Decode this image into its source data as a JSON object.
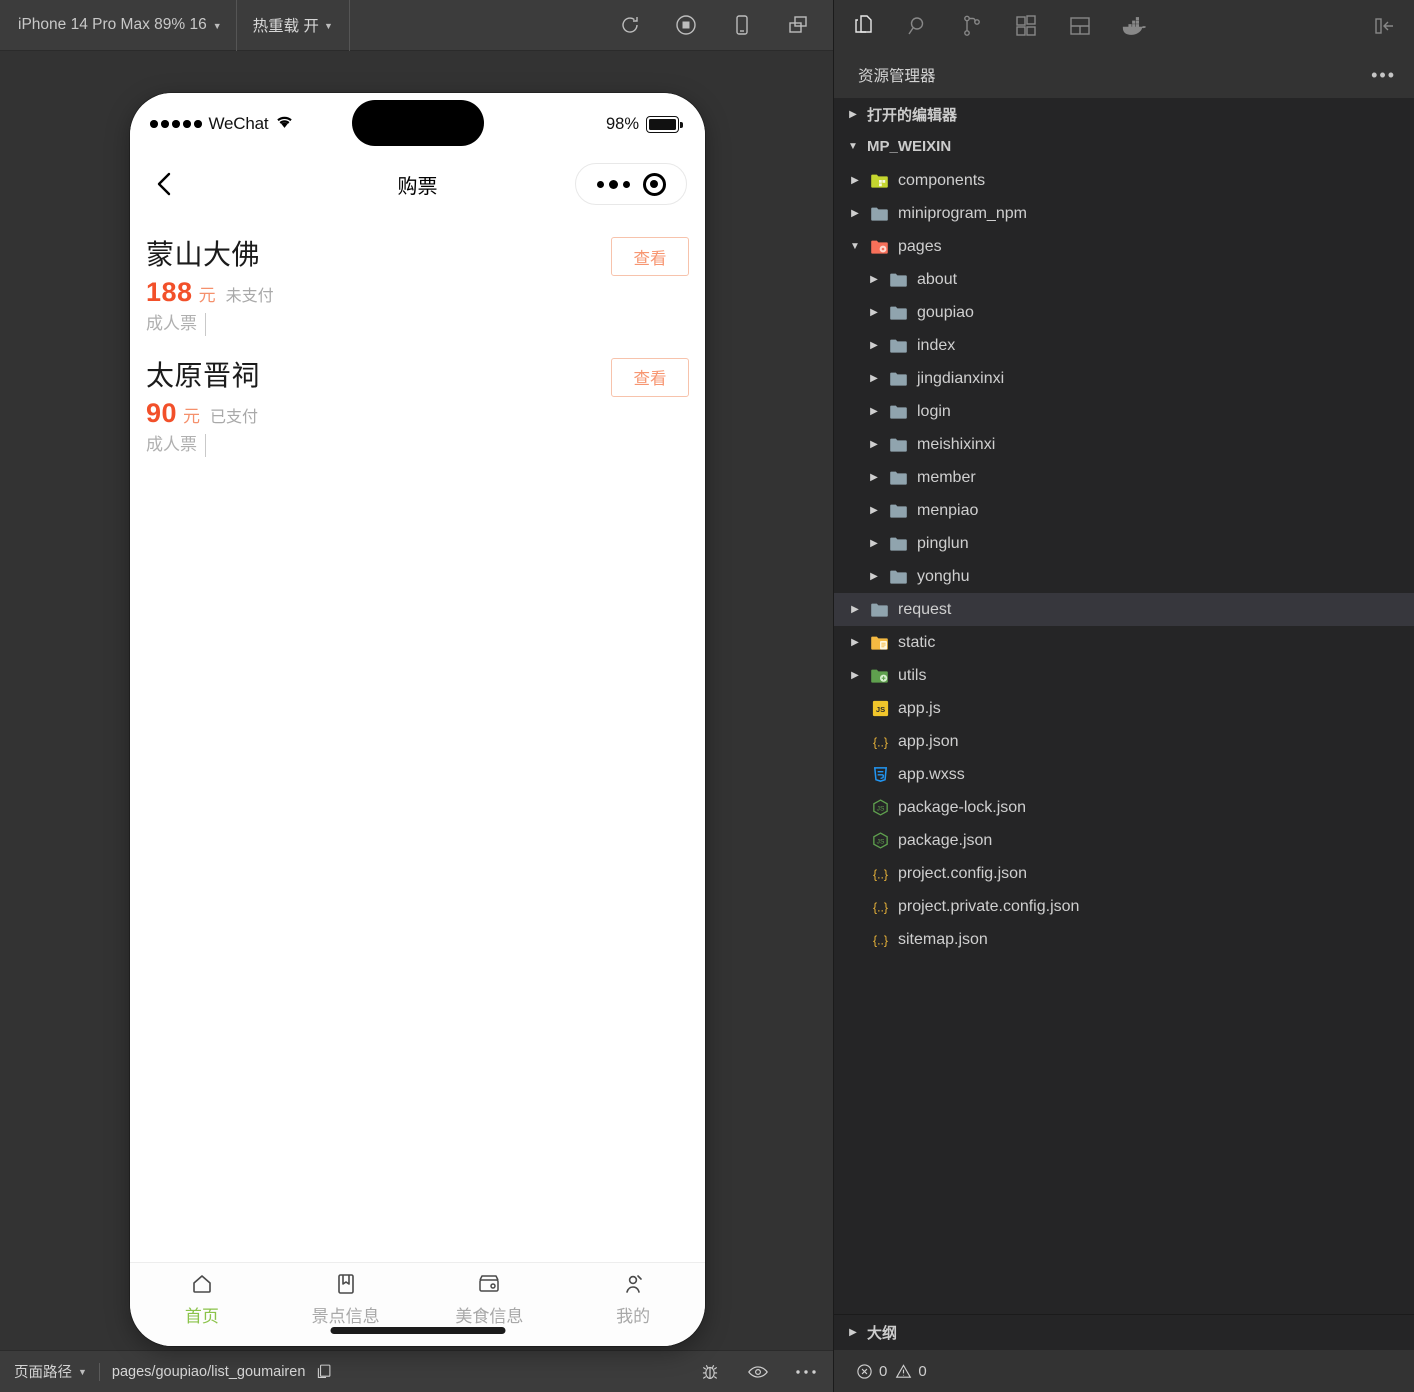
{
  "simulator": {
    "toolbar": {
      "device_label": "iPhone 14 Pro Max 89% 16",
      "hotreload_label": "热重载 开",
      "icons": [
        "refresh-icon",
        "record-stop-icon",
        "device-phone-icon",
        "window-split-icon"
      ]
    },
    "phone": {
      "status_bar": {
        "carrier": "WeChat",
        "signal_dots": 5,
        "wifi": "wifi-icon",
        "battery_percent": "98%"
      },
      "nav": {
        "back": "back-chevron-icon",
        "title": "购票",
        "capsule": [
          "more-dots-icon",
          "target-circle-icon"
        ]
      },
      "tickets": [
        {
          "name": "蒙山大佛",
          "price": "188",
          "currency": "元",
          "pay_status": "未支付",
          "ticket_type": "成人票",
          "action": "查看"
        },
        {
          "name": "太原晋祠",
          "price": "90",
          "currency": "元",
          "pay_status": "已支付",
          "ticket_type": "成人票",
          "action": "查看"
        }
      ],
      "tabbar": [
        {
          "label": "首页",
          "icon": "home-icon",
          "active": true
        },
        {
          "label": "景点信息",
          "icon": "bookmark-icon",
          "active": false
        },
        {
          "label": "美食信息",
          "icon": "shop-icon",
          "active": false
        },
        {
          "label": "我的",
          "icon": "person-icon",
          "active": false
        }
      ]
    },
    "path_bar": {
      "selector_label": "页面路径",
      "path": "pages/goupiao/list_goumairen",
      "copy_icon": "copy-icon",
      "right_icons": [
        "bug-icon",
        "eye-icon",
        "ellipsis-icon"
      ]
    }
  },
  "vscode": {
    "activity_bar": {
      "icons": [
        "explorer-files-icon",
        "search-icon",
        "source-control-icon",
        "extensions-icon",
        "layout-icon",
        "docker-icon"
      ],
      "collapse_icon": "collapse-panel-icon"
    },
    "panel_title": "资源管理器",
    "more_icon": "ellipsis-icon",
    "sections": {
      "open_editors": "打开的编辑器",
      "workspace": "MP_WEIXIN",
      "outline": "大纲"
    },
    "tree": [
      {
        "label": "components",
        "type": "folder",
        "icon_color": "#C5D62F",
        "indent": 0,
        "expanded": false
      },
      {
        "label": "miniprogram_npm",
        "type": "folder",
        "icon_color": "#90a4ae",
        "indent": 0,
        "expanded": false
      },
      {
        "label": "pages",
        "type": "folder",
        "icon_color": "#F8705A",
        "indent": 0,
        "expanded": true
      },
      {
        "label": "about",
        "type": "folder",
        "icon_color": "#90a4ae",
        "indent": 1,
        "expanded": false
      },
      {
        "label": "goupiao",
        "type": "folder",
        "icon_color": "#90a4ae",
        "indent": 1,
        "expanded": false
      },
      {
        "label": "index",
        "type": "folder",
        "icon_color": "#90a4ae",
        "indent": 1,
        "expanded": false
      },
      {
        "label": "jingdianxinxi",
        "type": "folder",
        "icon_color": "#90a4ae",
        "indent": 1,
        "expanded": false
      },
      {
        "label": "login",
        "type": "folder",
        "icon_color": "#90a4ae",
        "indent": 1,
        "expanded": false
      },
      {
        "label": "meishixinxi",
        "type": "folder",
        "icon_color": "#90a4ae",
        "indent": 1,
        "expanded": false
      },
      {
        "label": "member",
        "type": "folder",
        "icon_color": "#90a4ae",
        "indent": 1,
        "expanded": false
      },
      {
        "label": "menpiao",
        "type": "folder",
        "icon_color": "#90a4ae",
        "indent": 1,
        "expanded": false
      },
      {
        "label": "pinglun",
        "type": "folder",
        "icon_color": "#90a4ae",
        "indent": 1,
        "expanded": false
      },
      {
        "label": "yonghu",
        "type": "folder",
        "icon_color": "#90a4ae",
        "indent": 1,
        "expanded": false
      },
      {
        "label": "request",
        "type": "folder",
        "icon_color": "#90a4ae",
        "indent": 0,
        "expanded": false,
        "selected": true
      },
      {
        "label": "static",
        "type": "folder",
        "icon_color": "#F4B942",
        "indent": 0,
        "expanded": false
      },
      {
        "label": "utils",
        "type": "folder",
        "icon_color": "#5FA04E",
        "indent": 0,
        "expanded": false
      },
      {
        "label": "app.js",
        "type": "file",
        "icon": "js",
        "indent": 0
      },
      {
        "label": "app.json",
        "type": "file",
        "icon": "json",
        "indent": 0
      },
      {
        "label": "app.wxss",
        "type": "file",
        "icon": "css",
        "indent": 0
      },
      {
        "label": "package-lock.json",
        "type": "file",
        "icon": "node",
        "indent": 0
      },
      {
        "label": "package.json",
        "type": "file",
        "icon": "node",
        "indent": 0
      },
      {
        "label": "project.config.json",
        "type": "file",
        "icon": "json",
        "indent": 0
      },
      {
        "label": "project.private.config.json",
        "type": "file",
        "icon": "json",
        "indent": 0
      },
      {
        "label": "sitemap.json",
        "type": "file",
        "icon": "json",
        "indent": 0
      }
    ],
    "status": {
      "errors": "0",
      "warnings": "0"
    }
  },
  "colors": {
    "accent_orange": "#F2502A",
    "accent_orange_light": "#F79671",
    "tab_active_green": "#8BC34A",
    "vs_bg": "#252526",
    "vs_chrome": "#333333",
    "sim_bg": "#333333"
  }
}
